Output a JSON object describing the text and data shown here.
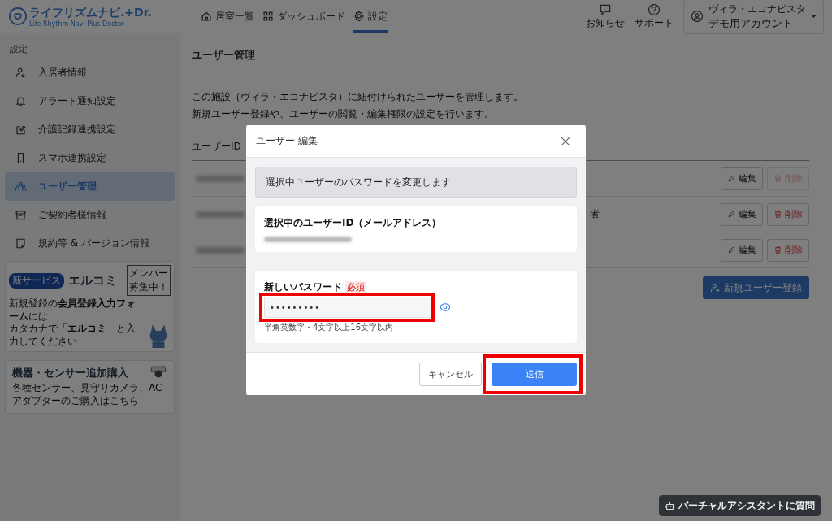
{
  "header": {
    "logo": "ライフリズムナビ.+Dr.",
    "logo_tagline": "Life Rhythm Navi Plus Doctor",
    "nav": [
      {
        "label": "居室一覧",
        "selected": false
      },
      {
        "label": "ダッシュボード",
        "selected": false
      },
      {
        "label": "設定",
        "selected": true
      }
    ],
    "actions": [
      "お知らせ",
      "サポート"
    ],
    "account": {
      "facility": "ヴィラ・エコナビスタ",
      "name": "デモ用アカウント"
    }
  },
  "sidebar": {
    "heading": "設定",
    "items": [
      {
        "label": "入居者情報",
        "selected": false
      },
      {
        "label": "アラート通知設定",
        "selected": false
      },
      {
        "label": "介護記録連携設定",
        "selected": false
      },
      {
        "label": "スマホ連携設定",
        "selected": false
      },
      {
        "label": "ユーザー管理",
        "selected": true
      },
      {
        "label": "ご契約者様情報",
        "selected": false
      },
      {
        "label": "規約等 & バージョン情報",
        "selected": false
      }
    ],
    "promo": {
      "badge": "新サービス",
      "title": "エルコミ",
      "sign": [
        "メンバー",
        "募集中！"
      ],
      "text": [
        "新規登録の**会員登録入力フォーム**には",
        "カタカナで「**エルコミ**」と入力してください"
      ]
    },
    "shop": {
      "title": "機器・センサー追加購入",
      "text": "各種センサー、見守りカメラ、ACアダプターのご購入はこちら"
    }
  },
  "main": {
    "title": "ユーザー管理",
    "description": [
      "この施設（ヴィラ・エコナビスタ）に紐付けられたユーザーを管理します。",
      "新規ユーザー登録や、ユーザーの閲覧・編集権限の設定を行います。"
    ],
    "column_1": "ユーザーID",
    "rows": [
      {
        "role": "",
        "edit": "編集",
        "delete": "削除",
        "delete_disabled": true
      },
      {
        "role": "者",
        "edit": "編集",
        "delete": "削除",
        "delete_disabled": false
      },
      {
        "role": "",
        "edit": "編集",
        "delete": "削除",
        "delete_disabled": false
      }
    ],
    "new_user_button": "新規ユーザー登録"
  },
  "modal": {
    "title": "ユーザー 編集",
    "notice": "選択中ユーザーのパスワードを変更します",
    "id_label": "選択中のユーザーID（メールアドレス）",
    "password_label": "新しいパスワード",
    "required": "必須",
    "password_value": "•••••••••",
    "hint": "半角英数字・4文字以上16文字以内",
    "cancel": "キャンセル",
    "submit": "送信"
  },
  "assistant": "バーチャルアシスタントに質問"
}
